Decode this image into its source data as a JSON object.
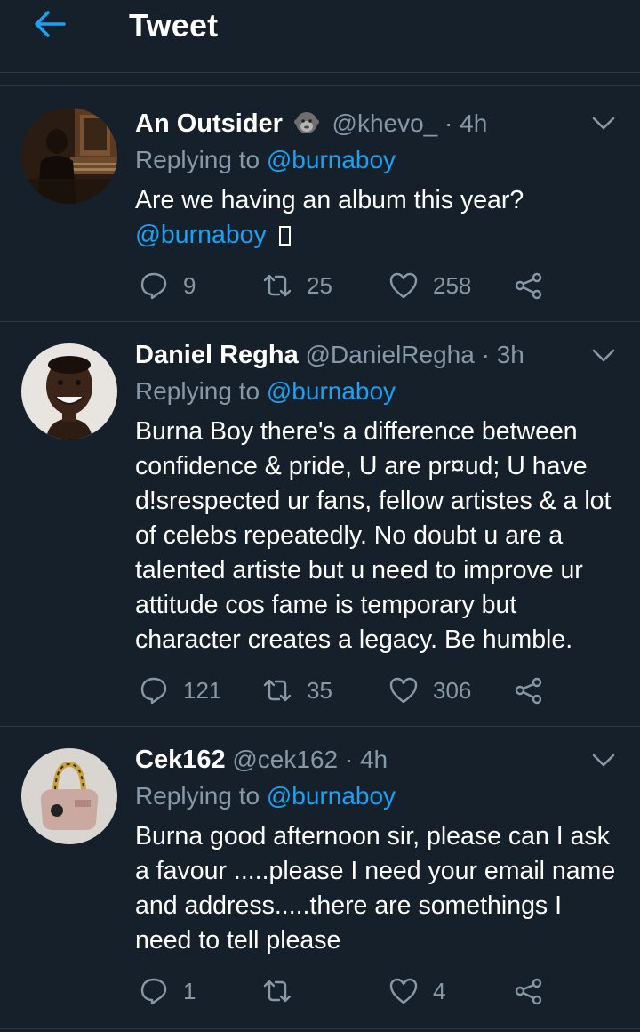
{
  "header": {
    "title": "Tweet"
  },
  "tweets": [
    {
      "name": "An Outsider",
      "emoji": "gorilla-emoji",
      "handle": "@khevo_",
      "dot": "·",
      "time": "4h",
      "reply_prefix": "Replying to",
      "reply_to": "@burnaboy",
      "text": "Are we having an album this year?",
      "text_mention": "@burnaboy",
      "replies": "9",
      "retweets": "25",
      "likes": "258"
    },
    {
      "name": "Daniel Regha",
      "handle": "@DanielRegha",
      "dot": "·",
      "time": "3h",
      "reply_prefix": "Replying to",
      "reply_to": "@burnaboy",
      "text": "Burna Boy there's a difference between confidence & pride, U are pr¤ud; U have d!srespected ur fans, fellow artistes & a lot of celebs repeatedly. No doubt u are a talented artiste but u need to improve ur attitude cos fame is temporary but character creates a legacy. Be humble.",
      "replies": "121",
      "retweets": "35",
      "likes": "306"
    },
    {
      "name": "Cek162",
      "handle": "@cek162",
      "dot": "·",
      "time": "4h",
      "reply_prefix": "Replying to",
      "reply_to": "@burnaboy",
      "text": "Burna good afternoon sir, please can I ask a favour .....please I need your email name and address.....there are somethings I need to tell please",
      "replies": "1",
      "retweets": "",
      "likes": "4"
    }
  ],
  "colors": {
    "background": "#15202b",
    "accent": "#1da1f2",
    "muted": "#8899a6",
    "divider": "#2b3743"
  }
}
